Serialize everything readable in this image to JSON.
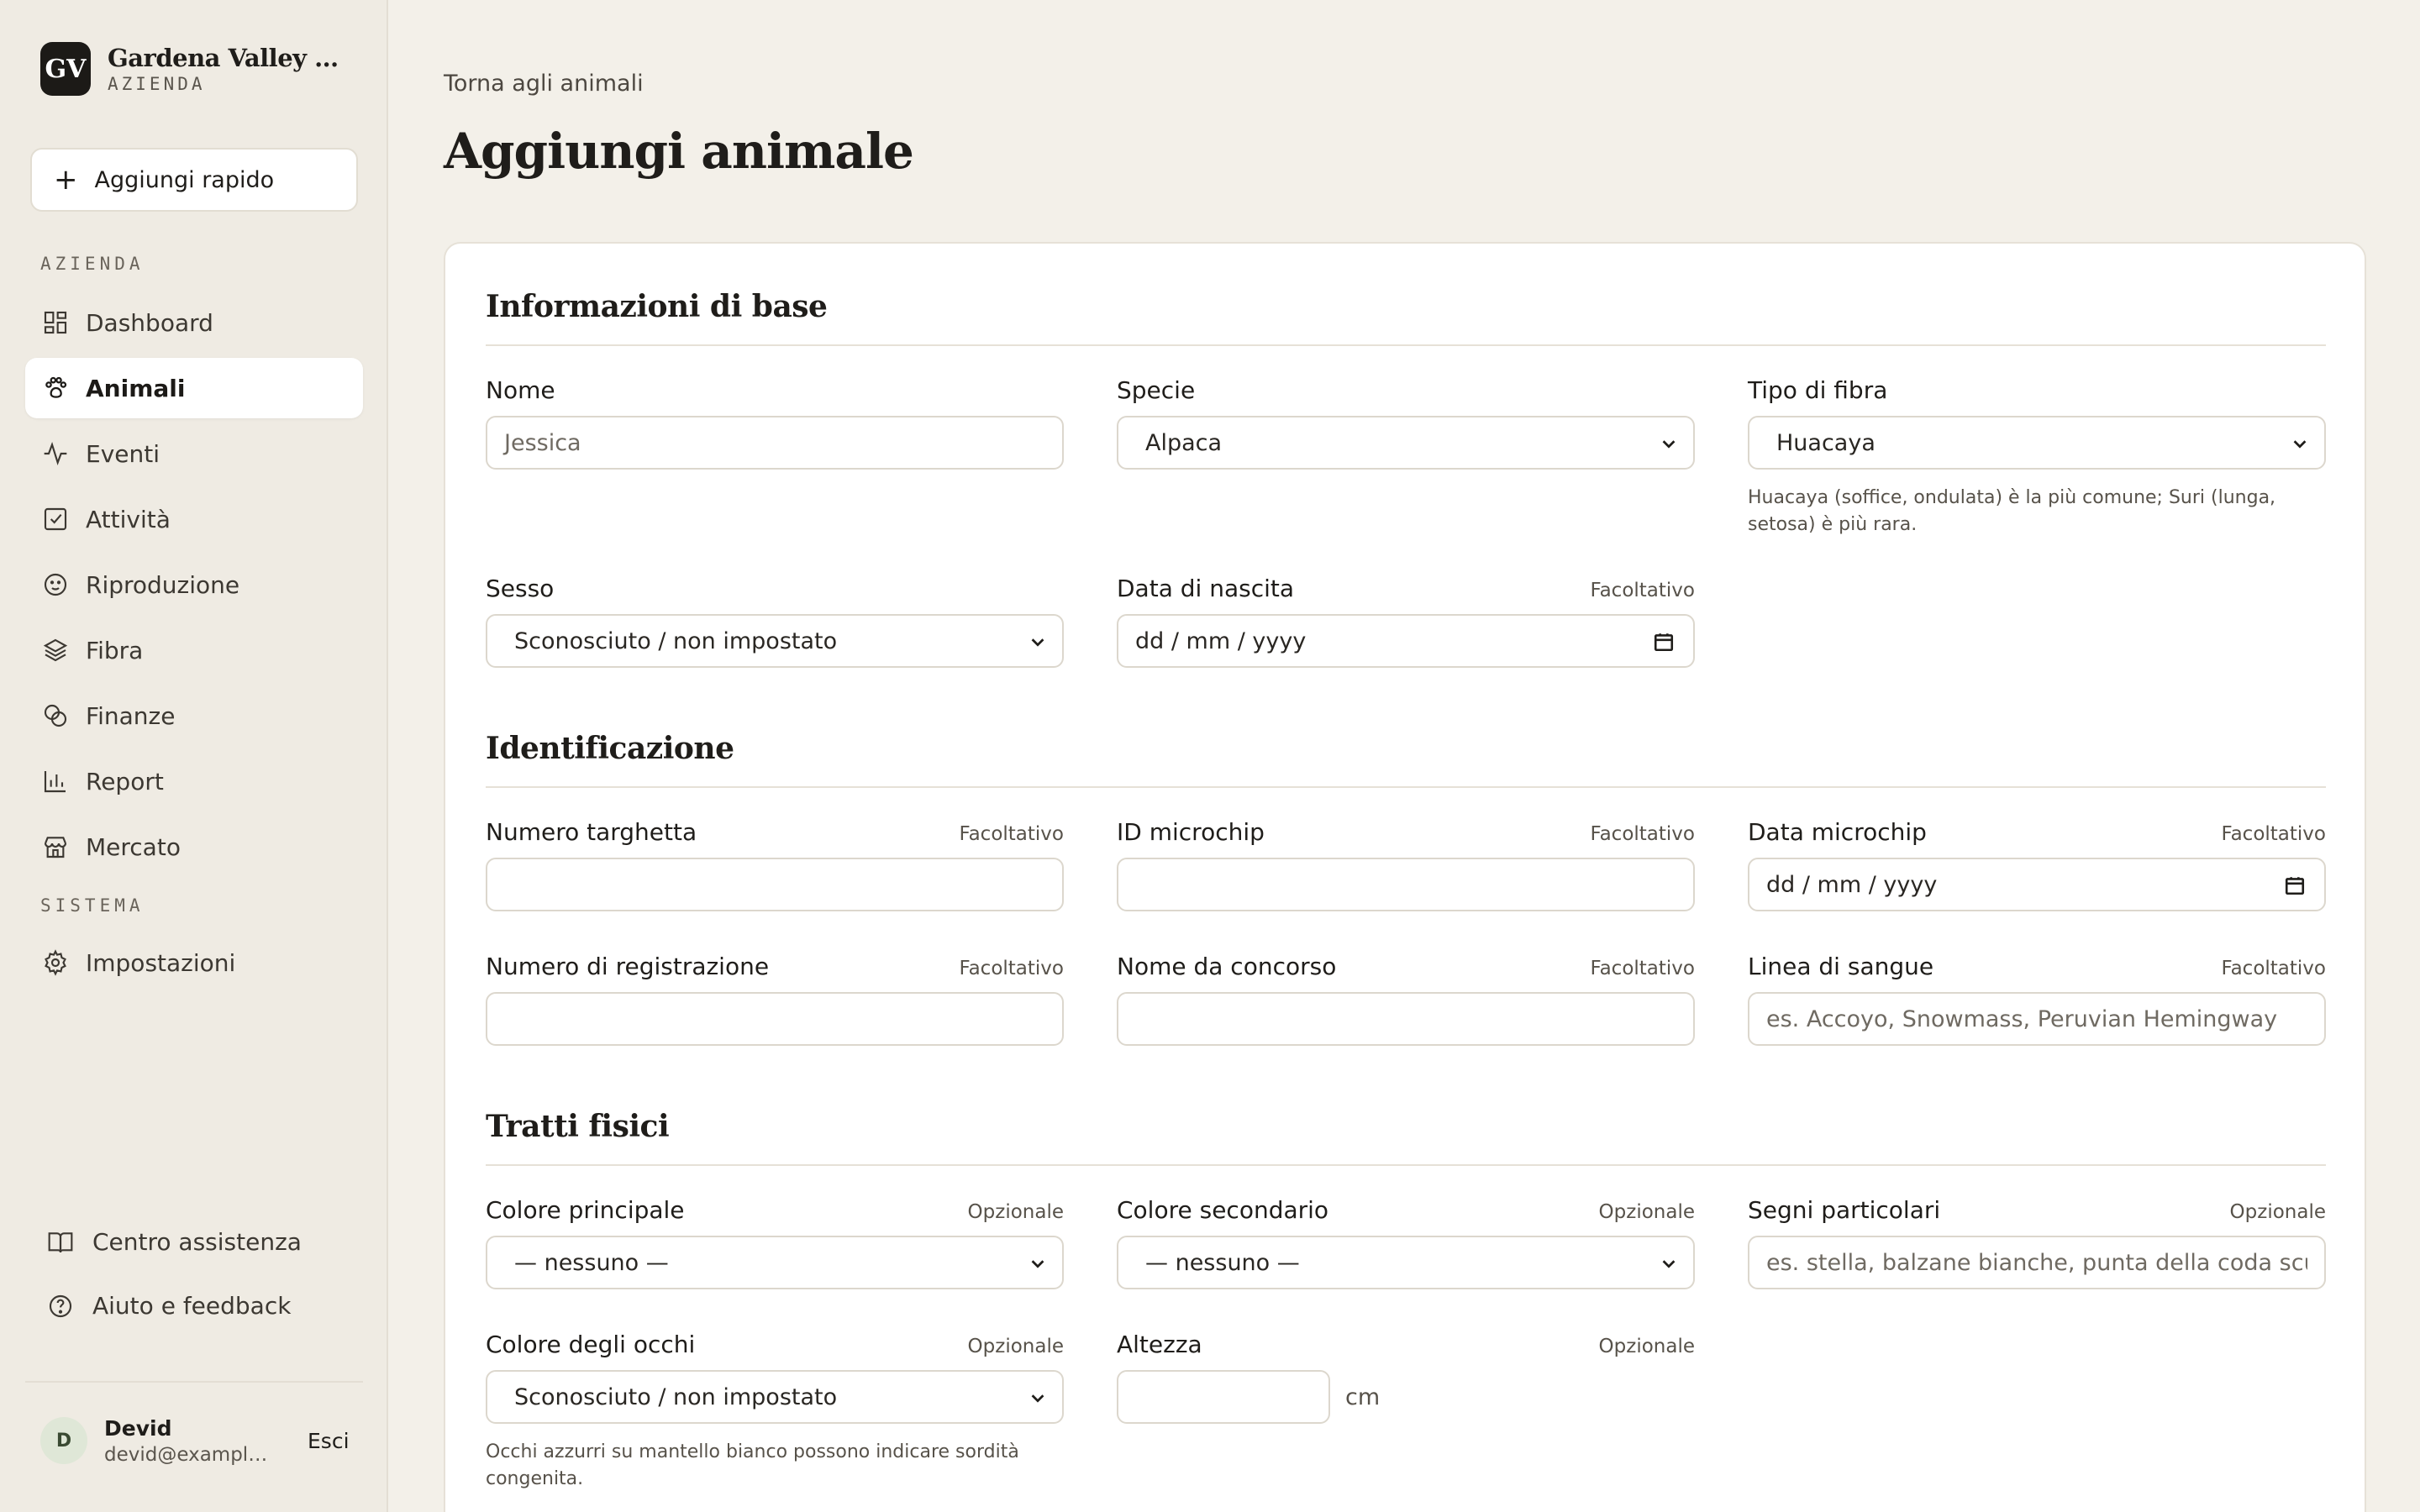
{
  "sidebar": {
    "brand_initials": "GV",
    "brand_name": "Gardena Valley Alpacas",
    "brand_sub": "AZIENDA",
    "quick_add": "Aggiungi rapido",
    "section_farm": "AZIENDA",
    "items": [
      {
        "label": "Dashboard",
        "icon": "dashboard-icon"
      },
      {
        "label": "Animali",
        "icon": "paw-icon",
        "active": true
      },
      {
        "label": "Eventi",
        "icon": "activity-icon"
      },
      {
        "label": "Attività",
        "icon": "checkbox-icon"
      },
      {
        "label": "Riproduzione",
        "icon": "baby-icon"
      },
      {
        "label": "Fibra",
        "icon": "layers-icon"
      },
      {
        "label": "Finanze",
        "icon": "coins-icon"
      },
      {
        "label": "Report",
        "icon": "bar-chart-icon"
      },
      {
        "label": "Mercato",
        "icon": "store-icon"
      }
    ],
    "section_system": "SISTEMA",
    "settings": "Impostazioni",
    "help_center": "Centro assistenza",
    "help_feedback": "Aiuto e feedback",
    "user": {
      "initial": "D",
      "name": "Devid",
      "email": "devid@example.com",
      "logout": "Esci"
    }
  },
  "main": {
    "back": "Torna agli animali",
    "title": "Aggiungi animale"
  },
  "basic": {
    "title": "Informazioni di base",
    "name_label": "Nome",
    "name_placeholder": "Jessica",
    "species_label": "Specie",
    "species_value": "Alpaca",
    "fiber_label": "Tipo di fibra",
    "fiber_value": "Huacaya",
    "fiber_hint": "Huacaya (soffice, ondulata) è la più comune; Suri (lunga, setosa) è più rara.",
    "sex_label": "Sesso",
    "sex_value": "Sconosciuto / non impostato",
    "birth_label": "Data di nascita",
    "birth_opt": "Facoltativo",
    "birth_placeholder": "dd / mm / yyyy"
  },
  "ident": {
    "title": "Identificazione",
    "tag_label": "Numero targhetta",
    "tag_opt": "Facoltativo",
    "chip_label": "ID microchip",
    "chip_opt": "Facoltativo",
    "chipdate_label": "Data microchip",
    "chipdate_opt": "Facoltativo",
    "chipdate_placeholder": "dd / mm / yyyy",
    "reg_label": "Numero di registrazione",
    "reg_opt": "Facoltativo",
    "show_label": "Nome da concorso",
    "show_opt": "Facoltativo",
    "blood_label": "Linea di sangue",
    "blood_opt": "Facoltativo",
    "blood_placeholder": "es. Accoyo, Snowmass, Peruvian Hemingway"
  },
  "traits": {
    "title": "Tratti fisici",
    "primary_label": "Colore principale",
    "primary_opt": "Opzionale",
    "primary_value": "— nessuno —",
    "secondary_label": "Colore secondario",
    "secondary_opt": "Opzionale",
    "secondary_value": "— nessuno —",
    "marks_label": "Segni particolari",
    "marks_opt": "Opzionale",
    "marks_placeholder": "es. stella, balzane bianche, punta della coda scura",
    "eye_label": "Colore degli occhi",
    "eye_opt": "Opzionale",
    "eye_value": "Sconosciuto / non impostato",
    "eye_hint": "Occhi azzurri su mantello bianco possono indicare sordità congenita.",
    "height_label": "Altezza",
    "height_opt": "Opzionale",
    "height_unit": "cm"
  }
}
